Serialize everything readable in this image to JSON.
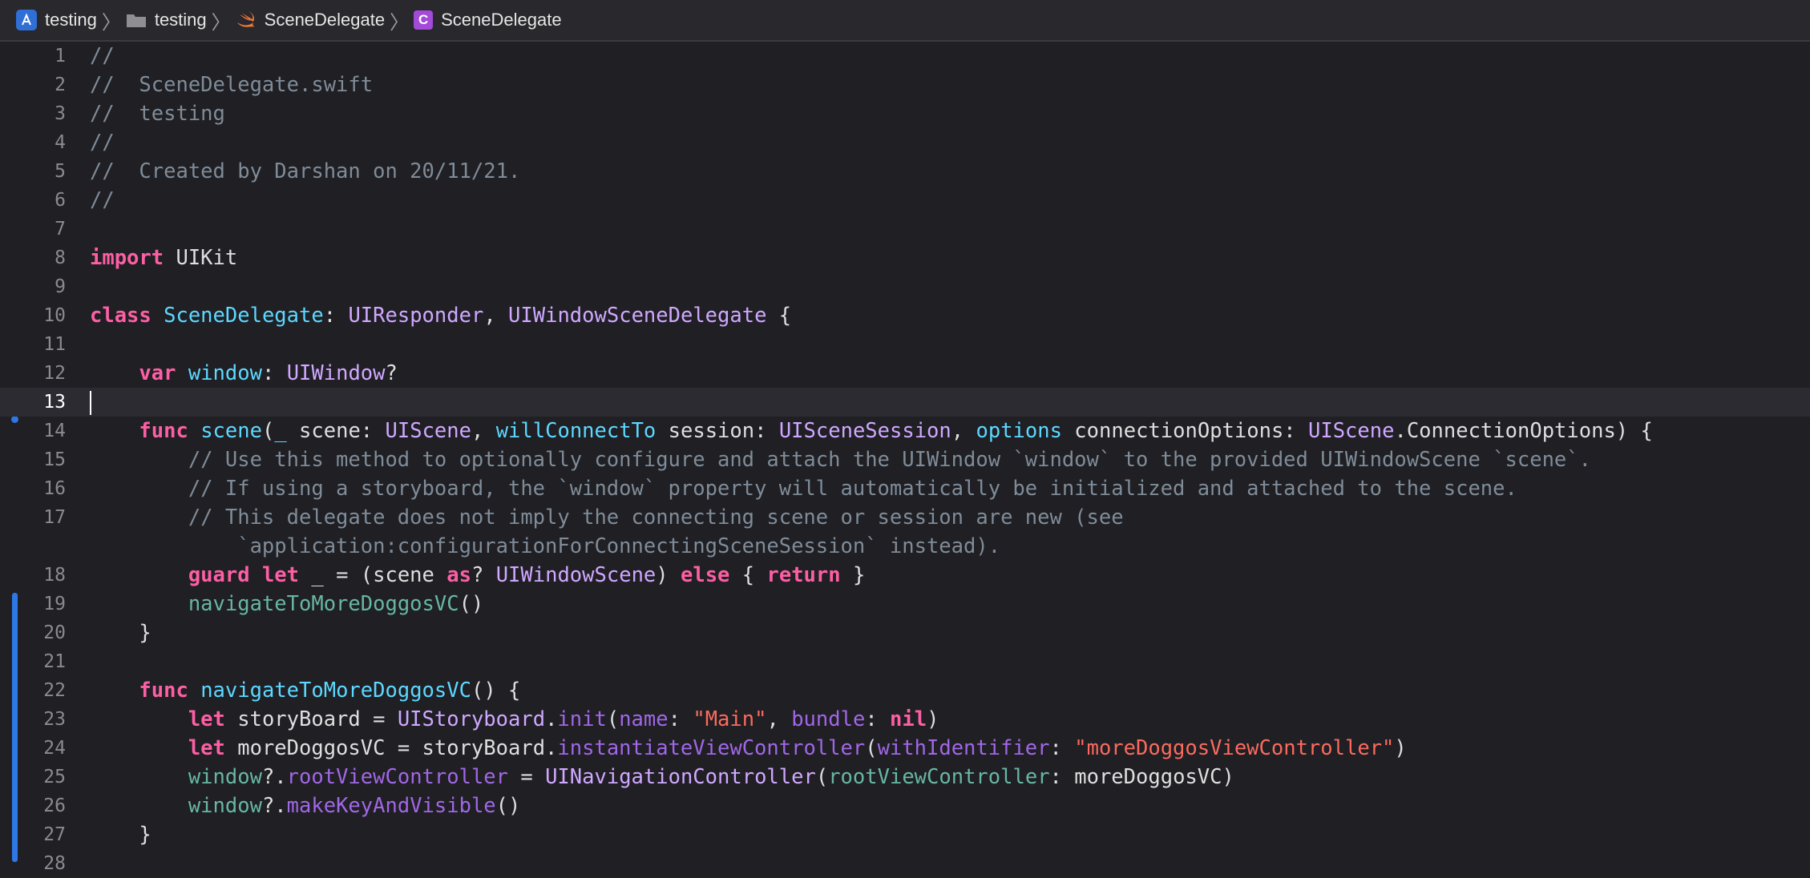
{
  "jump_bar": {
    "crumbs": [
      {
        "label": "testing",
        "icon": "xcode-project-icon"
      },
      {
        "label": "testing",
        "icon": "folder-icon"
      },
      {
        "label": "SceneDelegate",
        "icon": "swift-file-icon"
      },
      {
        "label": "SceneDelegate",
        "icon": "class-icon",
        "icon_text": "C"
      }
    ],
    "separator": "〉"
  },
  "editor": {
    "language": "swift",
    "current_line": 13,
    "colors": {
      "keyword": "#fc5fa3",
      "declaration": "#5dd8ff",
      "type": "#d0a8ff",
      "project_type": "#a167e6",
      "function": "#67b7a4",
      "string": "#fc6a5d",
      "comment": "#7f8c98",
      "change_bar": "#2e78e6"
    },
    "line_numbers": [
      "1",
      "2",
      "3",
      "4",
      "5",
      "6",
      "7",
      "8",
      "9",
      "10",
      "11",
      "12",
      "13",
      "14",
      "15",
      "16",
      "17",
      "18",
      "19",
      "20",
      "21",
      "22",
      "23",
      "24",
      "25",
      "26",
      "27",
      "28"
    ],
    "lines": {
      "l1": [
        "//"
      ],
      "l2": [
        "//  SceneDelegate.swift"
      ],
      "l3": [
        "//  testing"
      ],
      "l4": [
        "//"
      ],
      "l5": [
        "//  Created by Darshan on 20/11/21."
      ],
      "l6": [
        "//"
      ],
      "l8": [
        "import",
        " UIKit"
      ],
      "l10": [
        "class",
        " ",
        "SceneDelegate",
        ": ",
        "UIResponder",
        ", ",
        "UIWindowSceneDelegate",
        " {"
      ],
      "l12": [
        "    ",
        "var",
        " ",
        "window",
        ": ",
        "UIWindow",
        "?"
      ],
      "l14": [
        "    ",
        "func",
        " ",
        "scene",
        "(",
        "_",
        " scene: ",
        "UIScene",
        ", ",
        "willConnectTo",
        " session: ",
        "UISceneSession",
        ", ",
        "options",
        " connectionOptions: ",
        "UIScene",
        ".ConnectionOptions) {"
      ],
      "l15": [
        "        // Use this method to optionally configure and attach the UIWindow `window` to the provided UIWindowScene `scene`."
      ],
      "l16": [
        "        // If using a storyboard, the `window` property will automatically be initialized and attached to the scene."
      ],
      "l17a": [
        "        // This delegate does not imply the connecting scene or session are new (see"
      ],
      "l17b": [
        "            `application:configurationForConnectingSceneSession` instead)."
      ],
      "l18": [
        "        ",
        "guard",
        " ",
        "let",
        " _ = (scene ",
        "as",
        "? ",
        "UIWindowScene",
        ") ",
        "else",
        " { ",
        "return",
        " }"
      ],
      "l19": [
        "        ",
        "navigateToMoreDoggosVC",
        "()"
      ],
      "l20": [
        "    }"
      ],
      "l22": [
        "    ",
        "func",
        " ",
        "navigateToMoreDoggosVC",
        "() {"
      ],
      "l23": [
        "        ",
        "let",
        " storyBoard = ",
        "UIStoryboard",
        ".",
        "init",
        "(",
        "name",
        ": ",
        "\"Main\"",
        ", ",
        "bundle",
        ": ",
        "nil",
        ")"
      ],
      "l24": [
        "        ",
        "let",
        " moreDoggosVC = storyBoard.",
        "instantiateViewController",
        "(",
        "withIdentifier",
        ": ",
        "\"moreDoggosViewController\"",
        ")"
      ],
      "l25": [
        "        ",
        "window",
        "?.",
        "rootViewController",
        " = ",
        "UINavigationController",
        "(",
        "rootViewController",
        ": moreDoggosVC)"
      ],
      "l26": [
        "        ",
        "window",
        "?.",
        "makeKeyAndVisible",
        "()"
      ],
      "l27": [
        "    }"
      ]
    }
  }
}
